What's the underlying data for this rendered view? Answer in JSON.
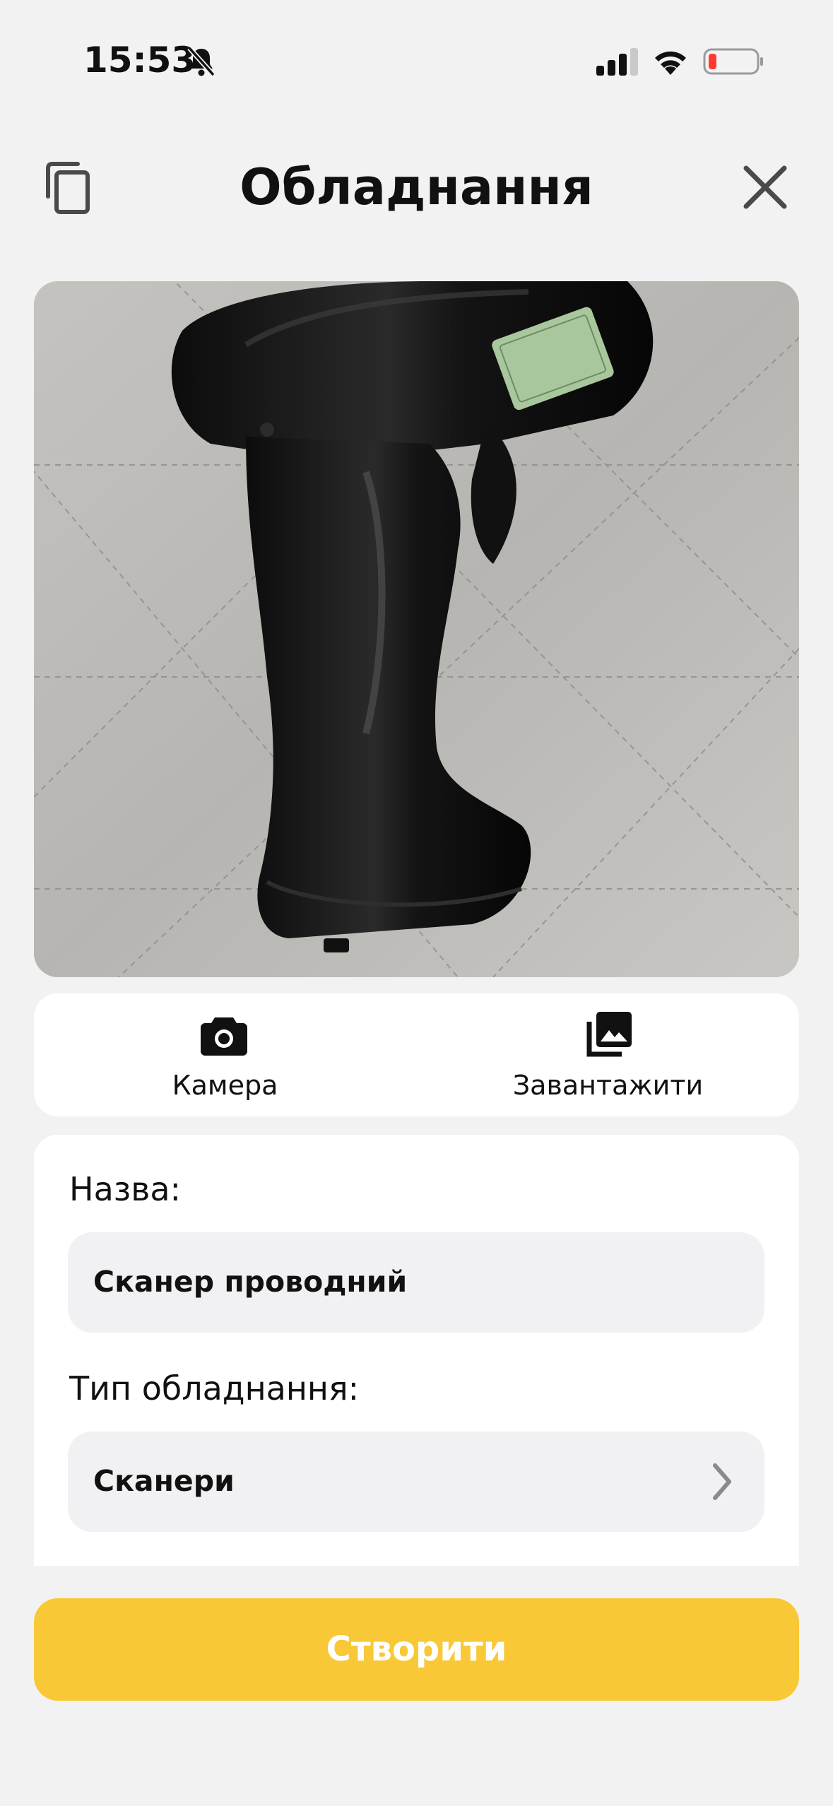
{
  "status_bar": {
    "time": "15:53"
  },
  "header": {
    "title": "Обладнання"
  },
  "photo_actions": {
    "camera_label": "Камера",
    "upload_label": "Завантажити"
  },
  "form": {
    "name_label": "Назва:",
    "name_value": "Сканер проводний",
    "type_label": "Тип обладнання:",
    "type_value": "Сканери"
  },
  "actions": {
    "create_label": "Створити"
  },
  "colors": {
    "accent": "#f8c836",
    "background": "#f2f2f3",
    "card": "#ffffff",
    "field": "#f1f1f3",
    "battery_low": "#ff3b30"
  },
  "icons": {
    "copy": "copy-icon",
    "close": "close-icon",
    "camera": "camera-icon",
    "upload": "image-gallery-icon",
    "chevron": "chevron-right-icon",
    "notifications_muted": "bell-slash-icon",
    "signal": "signal-icon",
    "wifi": "wifi-icon",
    "battery": "battery-icon"
  }
}
